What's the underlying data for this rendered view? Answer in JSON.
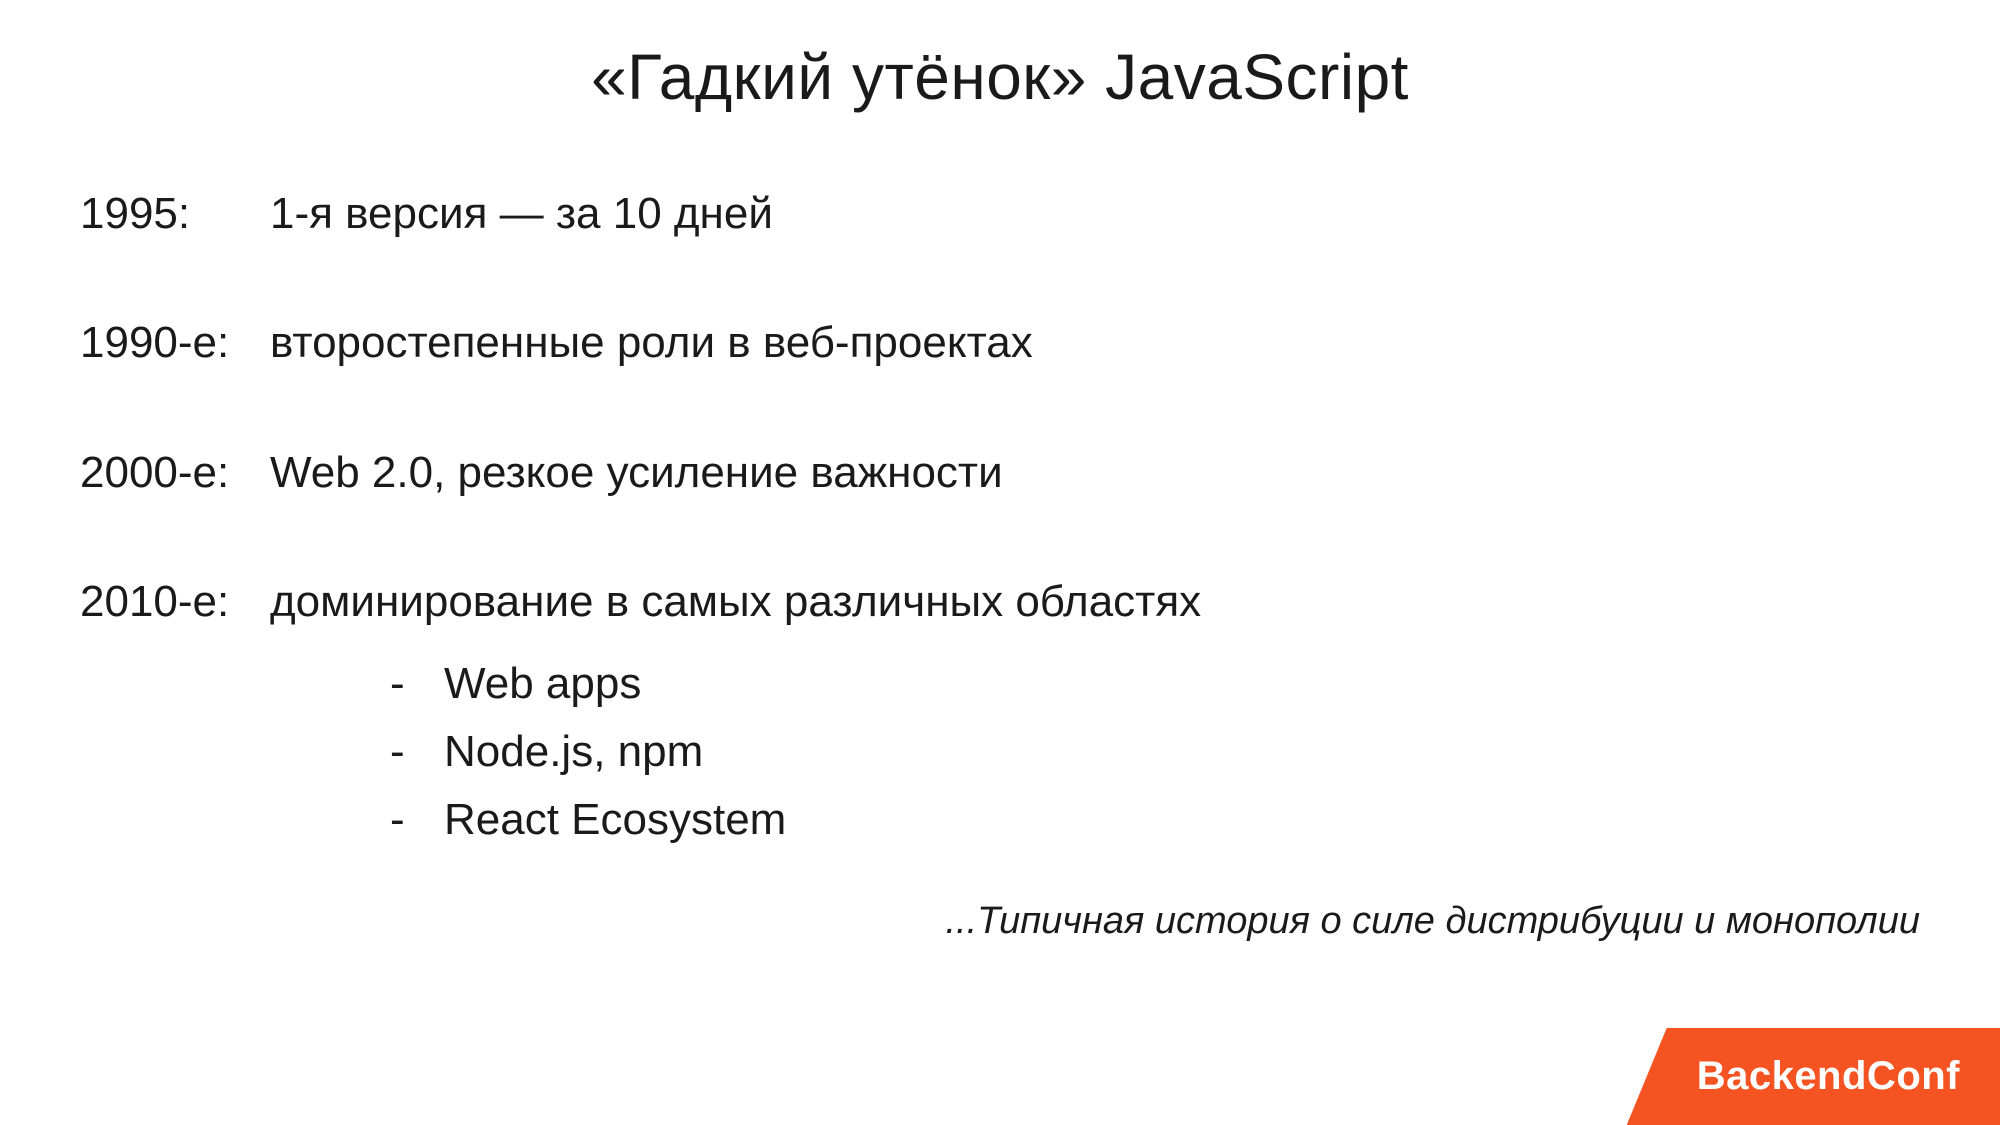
{
  "title": "«Гадкий утёнок»  JavaScript",
  "rows": [
    {
      "year": "1995:",
      "desc": "1-я версия  — за 10 дней",
      "sub": []
    },
    {
      "year": "1990-е:",
      "desc": "второстепенные роли в веб-проектах",
      "sub": []
    },
    {
      "year": "2000-е:",
      "desc": "Web 2.0, резкое усиление важности",
      "sub": []
    },
    {
      "year": "2010-е:",
      "desc": "доминирование в самых различных областях",
      "sub": [
        "Web apps",
        "Node.js, npm",
        "React Ecosystem"
      ]
    }
  ],
  "footnote": "...Типичная история о силе дистрибуции и монополии",
  "badge": "BackendConf",
  "colors": {
    "accent": "#f55422"
  }
}
